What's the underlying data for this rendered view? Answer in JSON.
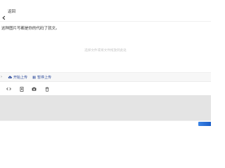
{
  "header": {
    "back_label": "返回"
  },
  "upload": {
    "instruction": "这种图片写都是你的代码了就文。",
    "drop_hint": "选择文件或将文件拖放到此处"
  },
  "upload_bar": {
    "start_upload": "开始上传",
    "pause_upload": "暂停上传"
  },
  "tools": [
    {
      "icon": "code-icon"
    },
    {
      "icon": "file-icon"
    },
    {
      "icon": "camera-icon"
    },
    {
      "icon": "trash-icon"
    }
  ],
  "colors": {
    "accent": "#2b4a9b",
    "submit": "#1c5fc8",
    "panel": "#e4e4e4"
  }
}
